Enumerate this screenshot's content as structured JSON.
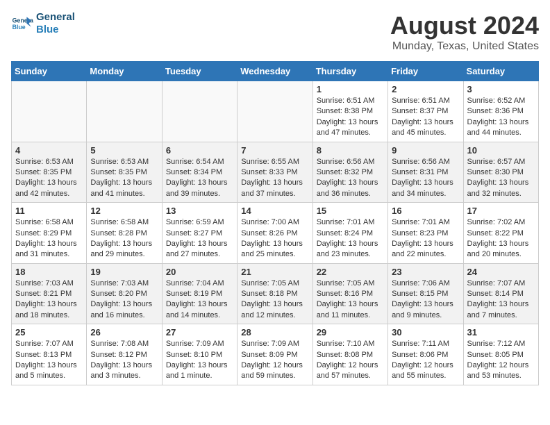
{
  "header": {
    "logo_line1": "General",
    "logo_line2": "Blue",
    "month_title": "August 2024",
    "location": "Munday, Texas, United States"
  },
  "days_of_week": [
    "Sunday",
    "Monday",
    "Tuesday",
    "Wednesday",
    "Thursday",
    "Friday",
    "Saturday"
  ],
  "weeks": [
    [
      {
        "day": "",
        "info": ""
      },
      {
        "day": "",
        "info": ""
      },
      {
        "day": "",
        "info": ""
      },
      {
        "day": "",
        "info": ""
      },
      {
        "day": "1",
        "info": "Sunrise: 6:51 AM\nSunset: 8:38 PM\nDaylight: 13 hours\nand 47 minutes."
      },
      {
        "day": "2",
        "info": "Sunrise: 6:51 AM\nSunset: 8:37 PM\nDaylight: 13 hours\nand 45 minutes."
      },
      {
        "day": "3",
        "info": "Sunrise: 6:52 AM\nSunset: 8:36 PM\nDaylight: 13 hours\nand 44 minutes."
      }
    ],
    [
      {
        "day": "4",
        "info": "Sunrise: 6:53 AM\nSunset: 8:35 PM\nDaylight: 13 hours\nand 42 minutes."
      },
      {
        "day": "5",
        "info": "Sunrise: 6:53 AM\nSunset: 8:35 PM\nDaylight: 13 hours\nand 41 minutes."
      },
      {
        "day": "6",
        "info": "Sunrise: 6:54 AM\nSunset: 8:34 PM\nDaylight: 13 hours\nand 39 minutes."
      },
      {
        "day": "7",
        "info": "Sunrise: 6:55 AM\nSunset: 8:33 PM\nDaylight: 13 hours\nand 37 minutes."
      },
      {
        "day": "8",
        "info": "Sunrise: 6:56 AM\nSunset: 8:32 PM\nDaylight: 13 hours\nand 36 minutes."
      },
      {
        "day": "9",
        "info": "Sunrise: 6:56 AM\nSunset: 8:31 PM\nDaylight: 13 hours\nand 34 minutes."
      },
      {
        "day": "10",
        "info": "Sunrise: 6:57 AM\nSunset: 8:30 PM\nDaylight: 13 hours\nand 32 minutes."
      }
    ],
    [
      {
        "day": "11",
        "info": "Sunrise: 6:58 AM\nSunset: 8:29 PM\nDaylight: 13 hours\nand 31 minutes."
      },
      {
        "day": "12",
        "info": "Sunrise: 6:58 AM\nSunset: 8:28 PM\nDaylight: 13 hours\nand 29 minutes."
      },
      {
        "day": "13",
        "info": "Sunrise: 6:59 AM\nSunset: 8:27 PM\nDaylight: 13 hours\nand 27 minutes."
      },
      {
        "day": "14",
        "info": "Sunrise: 7:00 AM\nSunset: 8:26 PM\nDaylight: 13 hours\nand 25 minutes."
      },
      {
        "day": "15",
        "info": "Sunrise: 7:01 AM\nSunset: 8:24 PM\nDaylight: 13 hours\nand 23 minutes."
      },
      {
        "day": "16",
        "info": "Sunrise: 7:01 AM\nSunset: 8:23 PM\nDaylight: 13 hours\nand 22 minutes."
      },
      {
        "day": "17",
        "info": "Sunrise: 7:02 AM\nSunset: 8:22 PM\nDaylight: 13 hours\nand 20 minutes."
      }
    ],
    [
      {
        "day": "18",
        "info": "Sunrise: 7:03 AM\nSunset: 8:21 PM\nDaylight: 13 hours\nand 18 minutes."
      },
      {
        "day": "19",
        "info": "Sunrise: 7:03 AM\nSunset: 8:20 PM\nDaylight: 13 hours\nand 16 minutes."
      },
      {
        "day": "20",
        "info": "Sunrise: 7:04 AM\nSunset: 8:19 PM\nDaylight: 13 hours\nand 14 minutes."
      },
      {
        "day": "21",
        "info": "Sunrise: 7:05 AM\nSunset: 8:18 PM\nDaylight: 13 hours\nand 12 minutes."
      },
      {
        "day": "22",
        "info": "Sunrise: 7:05 AM\nSunset: 8:16 PM\nDaylight: 13 hours\nand 11 minutes."
      },
      {
        "day": "23",
        "info": "Sunrise: 7:06 AM\nSunset: 8:15 PM\nDaylight: 13 hours\nand 9 minutes."
      },
      {
        "day": "24",
        "info": "Sunrise: 7:07 AM\nSunset: 8:14 PM\nDaylight: 13 hours\nand 7 minutes."
      }
    ],
    [
      {
        "day": "25",
        "info": "Sunrise: 7:07 AM\nSunset: 8:13 PM\nDaylight: 13 hours\nand 5 minutes."
      },
      {
        "day": "26",
        "info": "Sunrise: 7:08 AM\nSunset: 8:12 PM\nDaylight: 13 hours\nand 3 minutes."
      },
      {
        "day": "27",
        "info": "Sunrise: 7:09 AM\nSunset: 8:10 PM\nDaylight: 13 hours\nand 1 minute."
      },
      {
        "day": "28",
        "info": "Sunrise: 7:09 AM\nSunset: 8:09 PM\nDaylight: 12 hours\nand 59 minutes."
      },
      {
        "day": "29",
        "info": "Sunrise: 7:10 AM\nSunset: 8:08 PM\nDaylight: 12 hours\nand 57 minutes."
      },
      {
        "day": "30",
        "info": "Sunrise: 7:11 AM\nSunset: 8:06 PM\nDaylight: 12 hours\nand 55 minutes."
      },
      {
        "day": "31",
        "info": "Sunrise: 7:12 AM\nSunset: 8:05 PM\nDaylight: 12 hours\nand 53 minutes."
      }
    ]
  ]
}
